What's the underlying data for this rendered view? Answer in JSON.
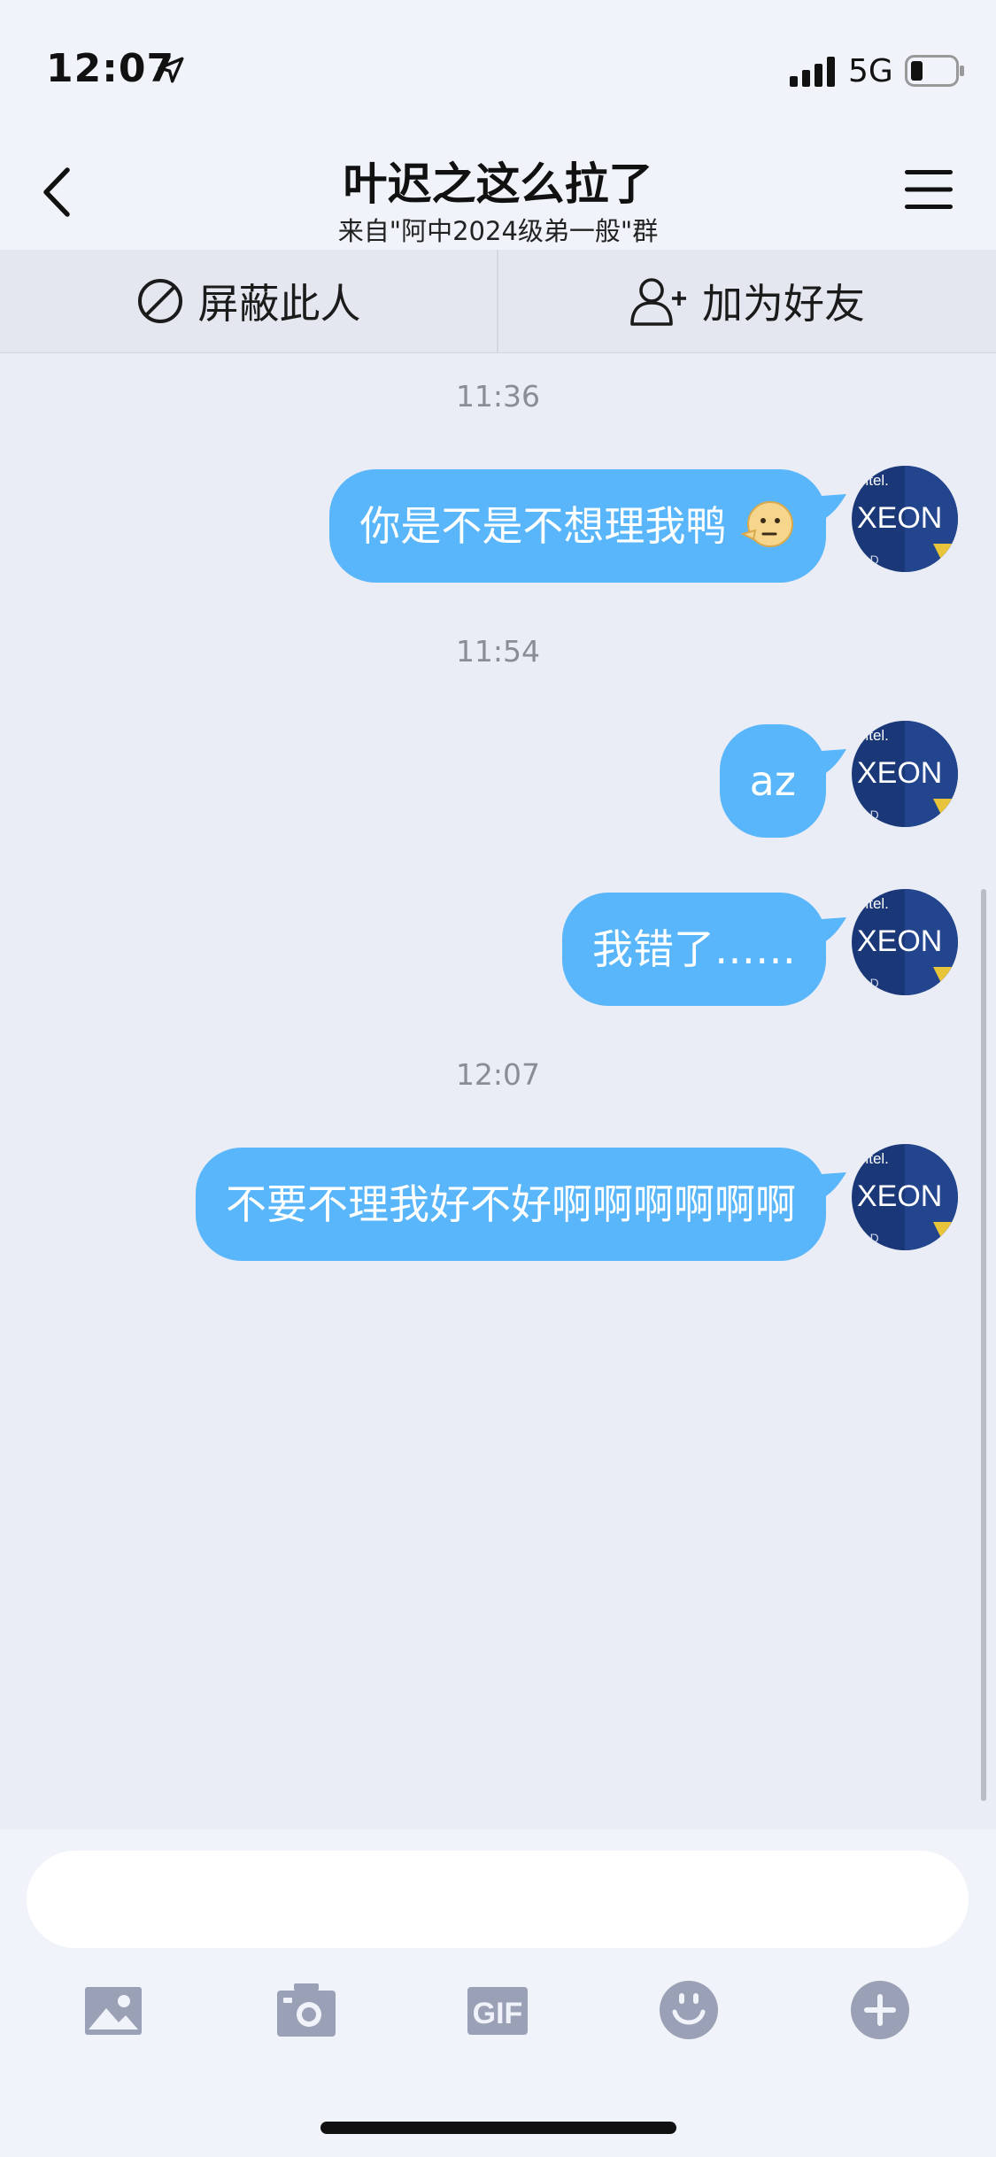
{
  "status_bar": {
    "time": "12:07",
    "network": "5G"
  },
  "header": {
    "title": "叶迟之这么拉了",
    "subtitle": "来自\"阿中2024级弟一般\"群"
  },
  "actions": {
    "block_label": "屏蔽此人",
    "add_friend_label": "加为好友"
  },
  "messages": [
    {
      "time": "11:36",
      "text": "你是不是不想理我鸭"
    },
    {
      "time": "11:54",
      "text": "az"
    },
    {
      "time": "",
      "text": "我错了……"
    },
    {
      "time": "12:07",
      "text": "不要不理我好不好啊啊啊啊啊啊"
    }
  ],
  "avatar": {
    "brand": "intel.",
    "product": "XEON",
    "tier": "OLD"
  },
  "input": {
    "value": "",
    "placeholder": ""
  },
  "toolbar": [
    "image-icon",
    "camera-icon",
    "gif-icon",
    "emoji-icon",
    "plus-icon"
  ],
  "toolbar_gif_label": "GIF",
  "colors": {
    "bubble": "#59b6fa",
    "background": "#eaedf6",
    "toolbar_icon": "#9aa0b5"
  }
}
